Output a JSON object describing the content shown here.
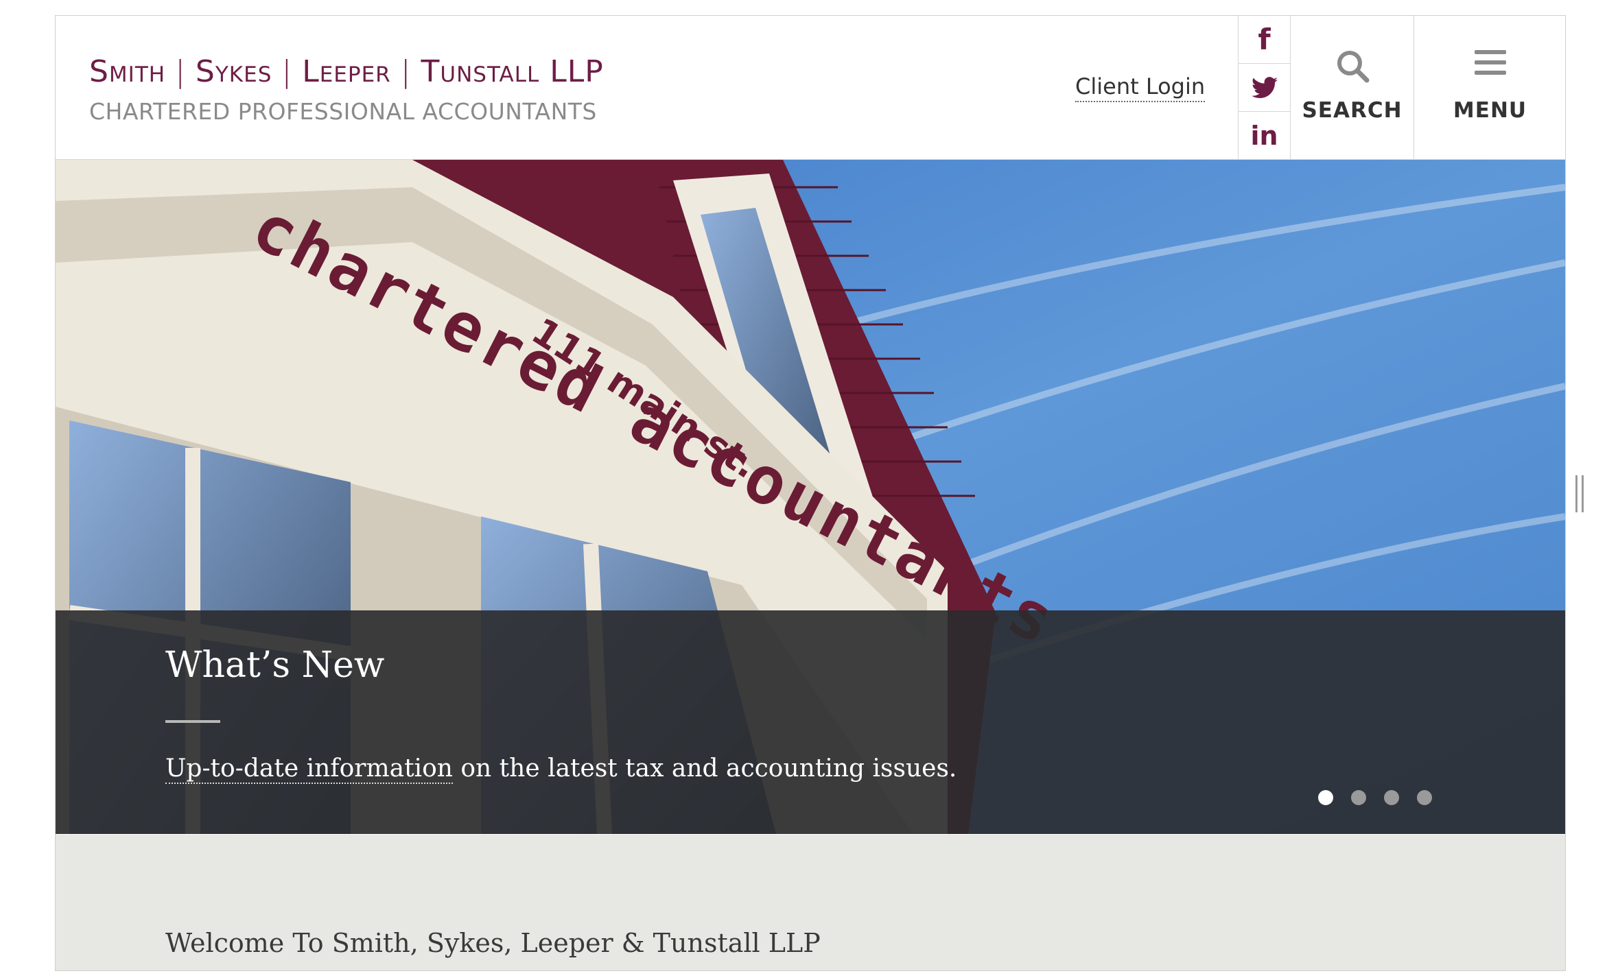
{
  "header": {
    "logo_line1": [
      "Smith",
      "Sykes",
      "Leeper",
      "Tunstall LLP"
    ],
    "logo_sep": "|",
    "logo_line2": "CHARTERED PROFESSIONAL ACCOUNTANTS",
    "client_login": "Client Login",
    "search_label": "SEARCH",
    "menu_label": "MENU",
    "social": [
      "facebook-icon",
      "twitter-icon",
      "linkedin-icon"
    ],
    "social_fb_glyph": "f",
    "social_in_glyph": "in"
  },
  "hero": {
    "sign_text": "chartered accountants",
    "address_text": "111 main st.",
    "caption_title": "What’s New",
    "caption_link": "Up-to-date information",
    "caption_rest": " on the latest tax and accounting issues.",
    "slides_total": 4,
    "active_slide": 1
  },
  "main": {
    "welcome_title": "Welcome To Smith, Sykes, Leeper & Tunstall LLP"
  },
  "colors": {
    "brand": "#6d1d45",
    "caption_bg": "#2a2b2e",
    "lower_bg": "#e7e7e3"
  }
}
